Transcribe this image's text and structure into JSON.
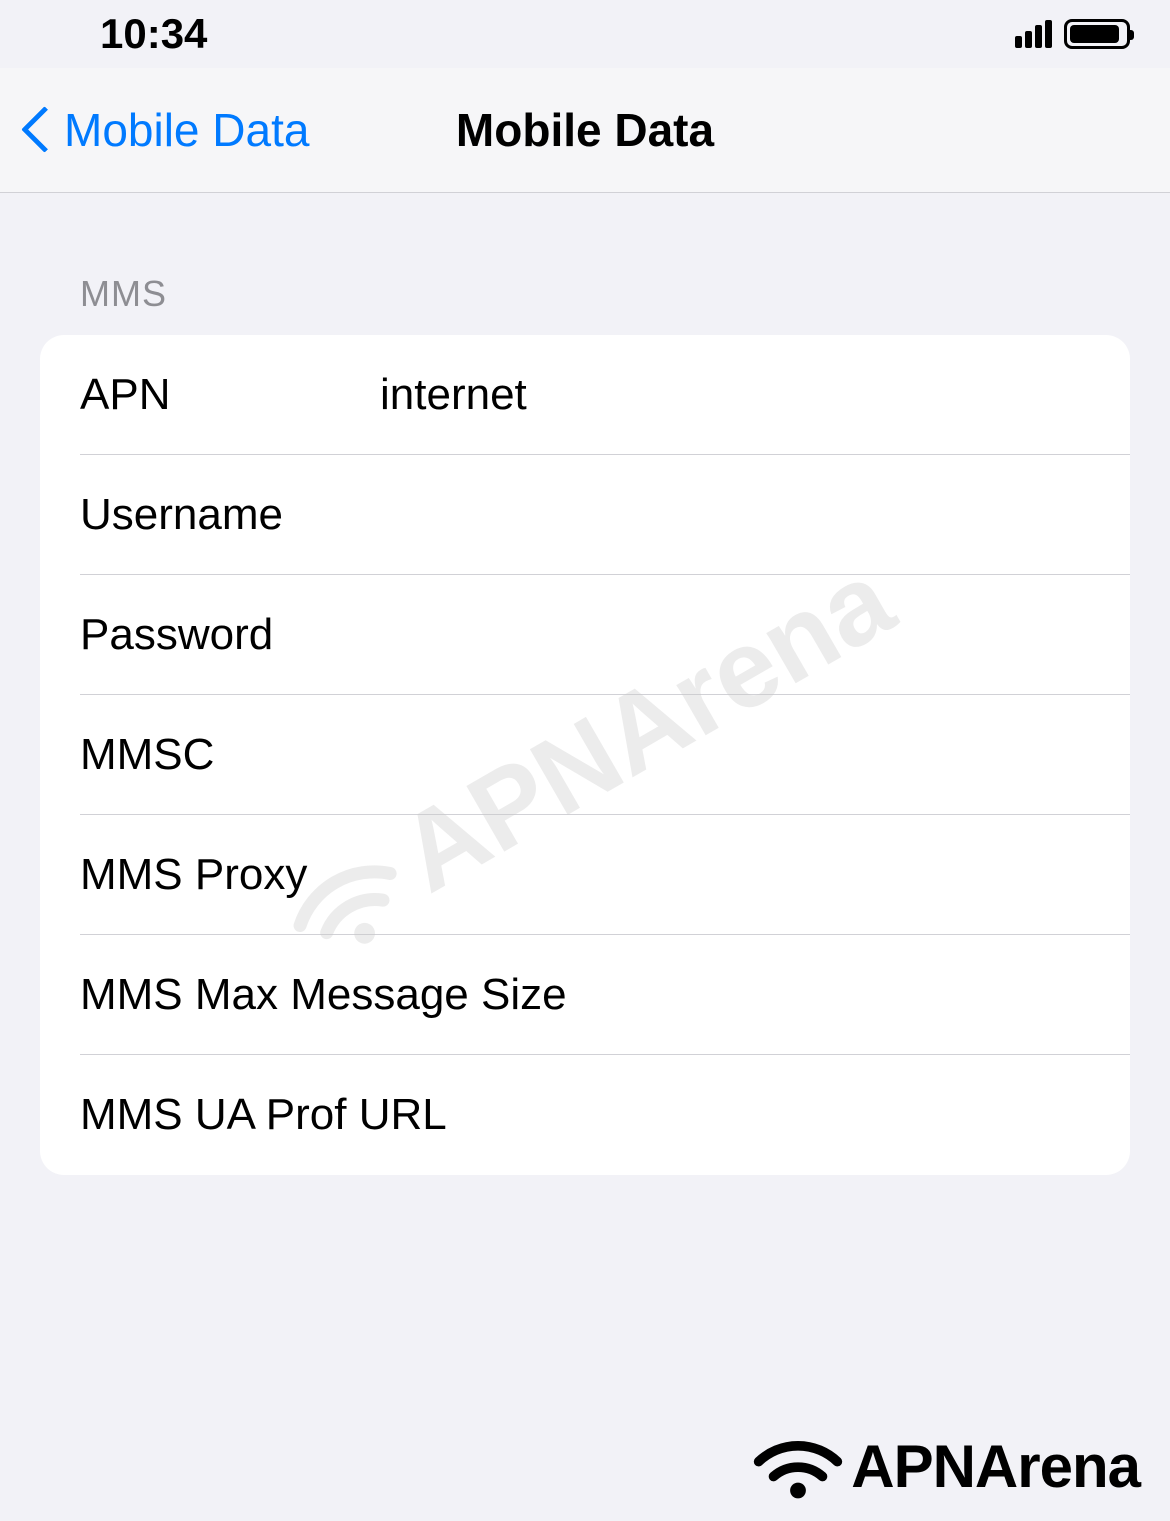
{
  "status": {
    "time": "10:34"
  },
  "nav": {
    "back_label": "Mobile Data",
    "title": "Mobile Data"
  },
  "section": {
    "header": "MMS"
  },
  "fields": {
    "apn": {
      "label": "APN",
      "value": "internet"
    },
    "username": {
      "label": "Username",
      "value": ""
    },
    "password": {
      "label": "Password",
      "value": ""
    },
    "mmsc": {
      "label": "MMSC",
      "value": ""
    },
    "mms_proxy": {
      "label": "MMS Proxy",
      "value": ""
    },
    "mms_max_size": {
      "label": "MMS Max Message Size",
      "value": ""
    },
    "mms_ua_prof": {
      "label": "MMS UA Prof URL",
      "value": ""
    }
  },
  "watermark": {
    "text": "APNArena"
  },
  "footer": {
    "brand": "APNArena"
  }
}
